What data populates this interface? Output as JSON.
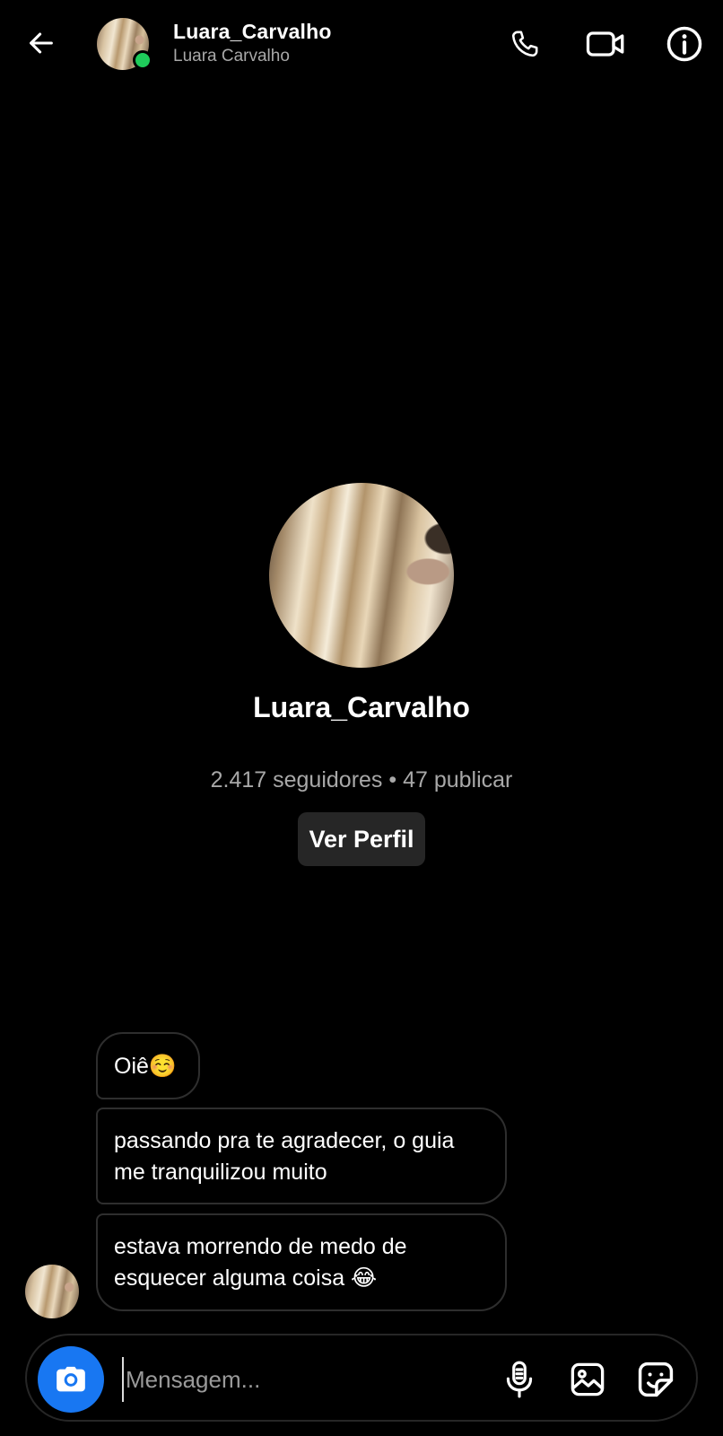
{
  "header": {
    "username": "Luara_Carvalho",
    "full_name": "Luara Carvalho",
    "online_status_color": "#1fcc5b",
    "icons": [
      "arrow-left-icon",
      "phone-icon",
      "video-camera-icon",
      "info-icon"
    ]
  },
  "profile": {
    "username": "Luara_Carvalho",
    "stats": "2.417 seguidores • 47 publicar",
    "view_profile_label": "Ver Perfil"
  },
  "messages": [
    {
      "sender": "Luara_Carvalho",
      "text": "Oiê☺️"
    },
    {
      "sender": "Luara_Carvalho",
      "text": "passando pra te agradecer, o guia me tranquilizou muito"
    },
    {
      "sender": "Luara_Carvalho",
      "text": "estava morrendo de medo de esquecer alguma coisa 😂"
    }
  ],
  "composer": {
    "placeholder": "Mensagem...",
    "value": "",
    "icons": [
      "camera-icon",
      "microphone-icon",
      "gallery-icon",
      "sticker-icon"
    ],
    "camera_button_color": "#1877f2"
  }
}
